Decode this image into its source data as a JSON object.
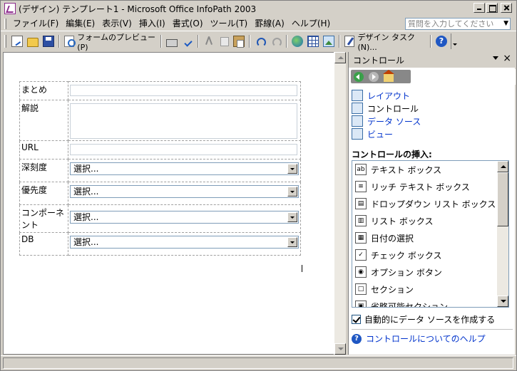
{
  "window": {
    "title": "(デザイン) テンプレート1 - Microsoft Office InfoPath 2003"
  },
  "menubar": {
    "items": [
      "ファイル(F)",
      "編集(E)",
      "表示(V)",
      "挿入(I)",
      "書式(O)",
      "ツール(T)",
      "罫線(A)",
      "ヘルプ(H)"
    ],
    "help_placeholder": "質問を入力してください"
  },
  "toolbar": {
    "preview_label": "フォームのプレビュー(P)",
    "design_tasks_label": "デザイン タスク(N)..."
  },
  "form": {
    "rows": [
      {
        "label": "まとめ",
        "type": "text",
        "value": ""
      },
      {
        "label": "解説",
        "type": "textarea",
        "value": ""
      },
      {
        "label": "URL",
        "type": "text",
        "value": ""
      },
      {
        "label": "深刻度",
        "type": "dropdown",
        "value": "選択..."
      },
      {
        "label": "優先度",
        "type": "dropdown",
        "value": "選択..."
      },
      {
        "label": "コンポーネント",
        "type": "dropdown",
        "value": "選択..."
      },
      {
        "label": "DB",
        "type": "dropdown",
        "value": "選択..."
      }
    ]
  },
  "taskpane": {
    "title": "コントロール",
    "links": [
      {
        "label": "レイアウト",
        "icon": "layout-icon",
        "is_link": true
      },
      {
        "label": "コントロール",
        "icon": "tools-icon",
        "is_link": false
      },
      {
        "label": "データ ソース",
        "icon": "datasource-icon",
        "is_link": true
      },
      {
        "label": "ビュー",
        "icon": "views-icon",
        "is_link": true
      }
    ],
    "insert_title": "コントロールの挿入:",
    "controls": [
      {
        "label": "テキスト ボックス",
        "icon": "textbox-icon"
      },
      {
        "label": "リッチ テキスト ボックス",
        "icon": "richtext-icon"
      },
      {
        "label": "ドロップダウン リスト ボックス",
        "icon": "dropdown-icon"
      },
      {
        "label": "リスト ボックス",
        "icon": "listbox-icon"
      },
      {
        "label": "日付の選択",
        "icon": "datepicker-icon"
      },
      {
        "label": "チェック ボックス",
        "icon": "checkbox-icon"
      },
      {
        "label": "オプション ボタン",
        "icon": "optionbutton-icon"
      },
      {
        "label": "セクション",
        "icon": "section-icon"
      },
      {
        "label": "省略可能セクション",
        "icon": "optional-section-icon"
      }
    ],
    "auto_create_label": "自動的にデータ ソースを作成する",
    "auto_create_checked": true,
    "help_label": "コントロールについてのヘルプ"
  },
  "colors": {
    "chrome": "#d4d0c8",
    "link": "#0033cc",
    "field_border": "#7f9db9"
  }
}
